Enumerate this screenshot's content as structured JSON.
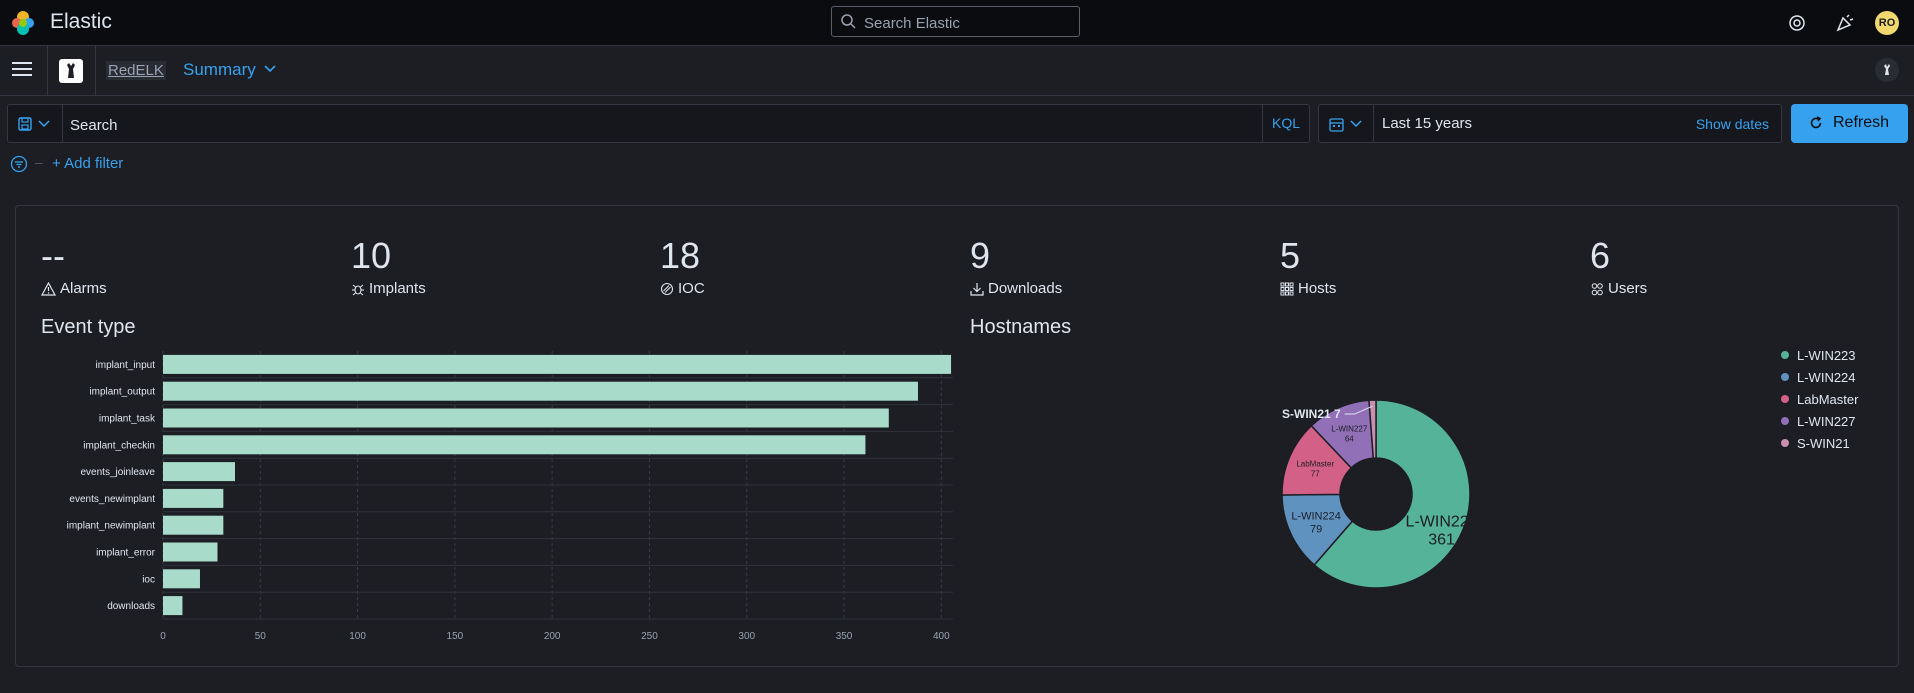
{
  "app": {
    "title": "Elastic"
  },
  "search": {
    "placeholder": "Search Elastic"
  },
  "user": {
    "initials": "RO"
  },
  "breadcrumbs": {
    "root": "RedELK",
    "current": "Summary"
  },
  "query": {
    "placeholder": "Search",
    "language": "KQL"
  },
  "time": {
    "range": "Last 15 years",
    "show_dates": "Show dates",
    "refresh": "Refresh"
  },
  "filter": {
    "add": "+ Add filter",
    "sep": "–"
  },
  "metrics": [
    {
      "value": "--",
      "label": "Alarms",
      "icon": "alert-icon"
    },
    {
      "value": "10",
      "label": "Implants",
      "icon": "bug-icon"
    },
    {
      "value": "18",
      "label": "IOC",
      "icon": "shield-icon"
    },
    {
      "value": "9",
      "label": "Downloads",
      "icon": "download-icon"
    },
    {
      "value": "5",
      "label": "Hosts",
      "icon": "grid-icon"
    },
    {
      "value": "6",
      "label": "Users",
      "icon": "users-icon"
    }
  ],
  "colors": {
    "accent": "#36a2ef",
    "bar": "#a8dbc9"
  },
  "chart_data": [
    {
      "type": "bar",
      "orientation": "horizontal",
      "title": "Event type",
      "categories": [
        "implant_input",
        "implant_output",
        "implant_task",
        "implant_checkin",
        "events_joinleave",
        "events_newimplant",
        "implant_newimplant",
        "implant_error",
        "ioc",
        "downloads"
      ],
      "values": [
        405,
        388,
        373,
        361,
        37,
        31,
        31,
        28,
        19,
        10
      ],
      "xticks": [
        0,
        50,
        100,
        150,
        200,
        250,
        300,
        350,
        400
      ],
      "xlim": [
        0,
        406
      ],
      "grid": true
    },
    {
      "type": "pie",
      "donut": true,
      "title": "Hostnames",
      "labels": [
        "L-WIN223",
        "L-WIN224",
        "LabMaster",
        "L-WIN227",
        "S-WIN21"
      ],
      "values": [
        361,
        79,
        77,
        64,
        7
      ],
      "colors": [
        "#54b399",
        "#6092c0",
        "#d36086",
        "#9170b8",
        "#ca8eae"
      ],
      "legend_position": "right"
    }
  ]
}
